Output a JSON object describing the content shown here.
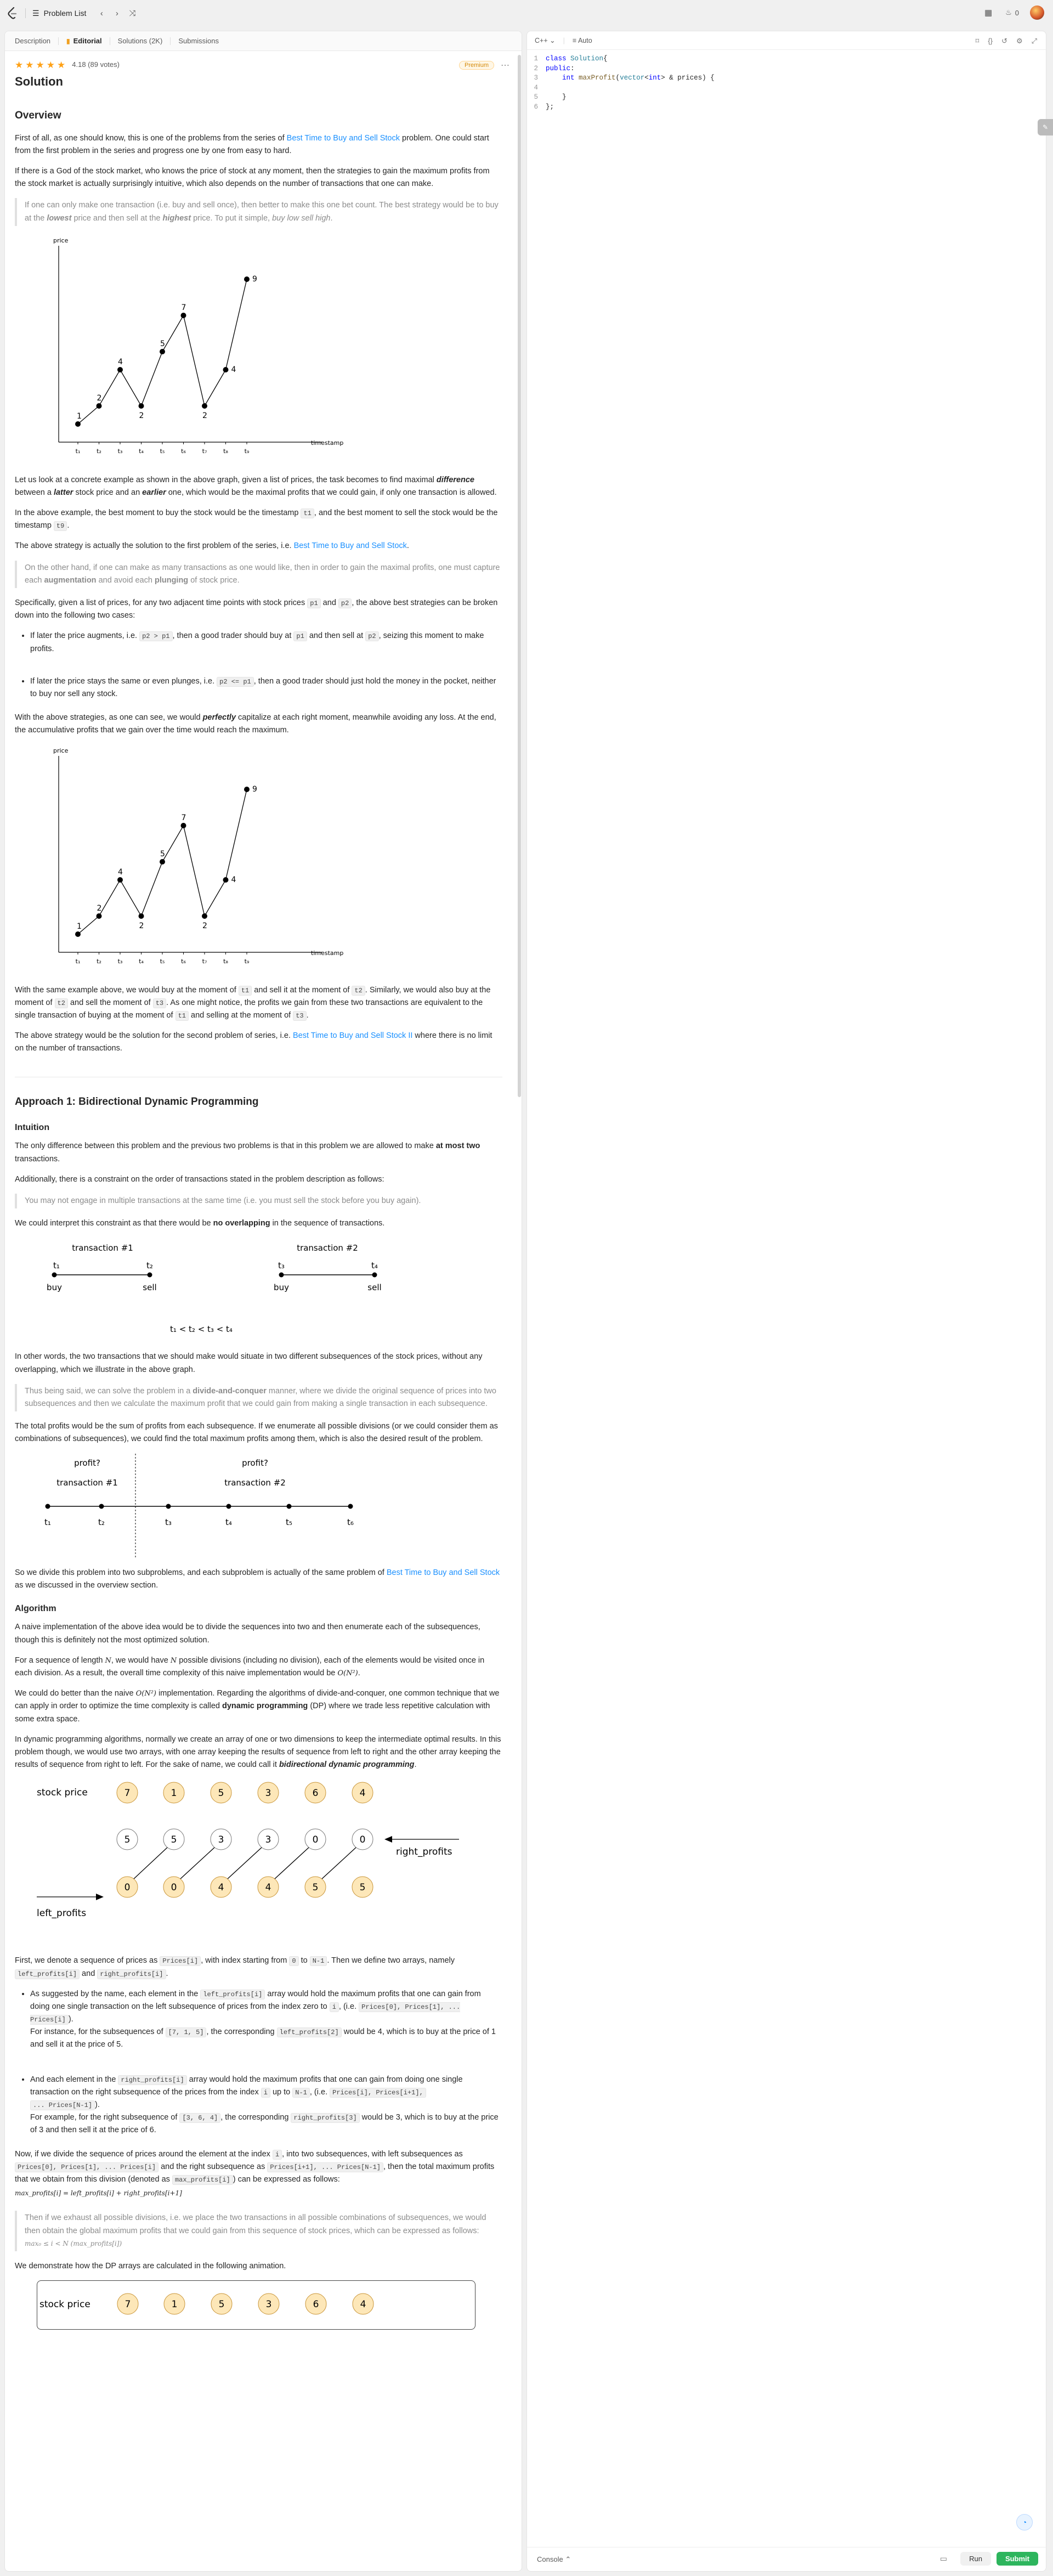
{
  "navbar": {
    "problem_list": "Problem List",
    "streak_count": "0"
  },
  "tabs": [
    {
      "label": "Description"
    },
    {
      "label": "Editorial"
    },
    {
      "label": "Solutions (2K)"
    },
    {
      "label": "Submissions"
    }
  ],
  "article": {
    "rating_text": "4.18 (89 votes)",
    "premium": "Premium",
    "title": "Solution",
    "overview_h": "Overview",
    "p1a": "First of all, as one should know, this is one of the problems from the series of ",
    "link_bs1": "Best Time to Buy and Sell Stock",
    "p1b": " problem. One could start from the first problem in the series and progress one by one from easy to hard.",
    "p2": "If there is a God of the stock market, who knows the price of stock at any moment, then the strategies to gain the maximum profits from the stock market is actually surprisingly intuitive, which also depends on the number of transactions that one can make.",
    "q1a": "If one can only make one transaction (i.e. buy and sell once), then better to make this one bet count. The best strategy would be to buy at the ",
    "q1_lowest": "lowest",
    "q1b": " price and then sell at the ",
    "q1_highest": "highest",
    "q1c": " price. To put it simple, ",
    "q1_em": "buy low sell high",
    "q1d": ".",
    "p3a": "Let us look at a concrete example as shown in the above graph, given a list of prices, the task becomes to find maximal ",
    "p3_diff": "difference",
    "p3b": " between a ",
    "p3_latter": "latter",
    "p3c": " stock price and an ",
    "p3_earlier": "earlier",
    "p3d": " one, which would be the maximal profits that we could gain, if only one transaction is allowed.",
    "p4a": "In the above example, the best moment to buy the stock would be the timestamp ",
    "p4_t1": "t1",
    "p4b": ", and the best moment to sell the stock would be the timestamp ",
    "p4_t9": "t9",
    "p4c": ".",
    "p5a": "The above strategy is actually the solution to the first problem of the series, i.e. ",
    "p5_link": "Best Time to Buy and Sell Stock",
    "p5b": ".",
    "q2a": "On the other hand, if one can make as many transactions as one would like, then in order to gain the maximal profits, one must capture each ",
    "q2_aug": "augmentation",
    "q2b": " and avoid each ",
    "q2_plunge": "plunging",
    "q2c": " of stock price.",
    "p6a": "Specifically, given a list of prices, for any two adjacent time points with stock prices ",
    "p6_p1": "p1",
    "p6b": " and ",
    "p6_p2": "p2",
    "p6c": ", the above best strategies can be broken down into the following two cases:",
    "li1a": "If later the price augments, i.e. ",
    "li1_code": "p2 > p1",
    "li1b": ", then a good trader should buy at ",
    "li1_p1": "p1",
    "li1c": " and then sell at ",
    "li1_p2": "p2",
    "li1d": ", seizing this moment to make profits.",
    "li2a": "If later the price stays the same or even plunges, i.e. ",
    "li2_code": "p2 <= p1",
    "li2b": ", then a good trader should just hold the money in the pocket, neither to buy nor sell any stock.",
    "p7a": "With the above strategies, as one can see, we would ",
    "p7_perf": "perfectly",
    "p7b": " capitalize at each right moment, meanwhile avoiding any loss. At the end, the accumulative profits that we gain over the time would reach the maximum.",
    "p8a": "With the same example above, we would buy at the moment of ",
    "p8_t1": "t1",
    "p8b": " and sell it at the moment of ",
    "p8_t2": "t2",
    "p8c": ". Similarly, we would also buy at the moment of ",
    "p8_t2b": "t2",
    "p8d": " and sell the moment of ",
    "p8_t3": "t3",
    "p8e": ". As one might notice, the profits we gain from these two transactions are equivalent to the single transaction of buying at the moment of ",
    "p8_t1b": "t1",
    "p8f": " and selling at the moment of ",
    "p8_t3b": "t3",
    "p8g": ".",
    "p9a": "The above strategy would be the solution for the second problem of series, i.e. ",
    "p9_link": "Best Time to Buy and Sell Stock II",
    "p9b": " where there is no limit on the number of transactions.",
    "approach_h": "Approach 1: Bidirectional Dynamic Programming",
    "intuition_h": "Intuition",
    "p10a": "The only difference between this problem and the previous two problems is that in this problem we are allowed to make ",
    "p10_strong": "at most two",
    "p10b": " transactions.",
    "p11": "Additionally, there is a constraint on the order of transactions stated in the problem description as follows:",
    "q3": "You may not engage in multiple transactions at the same time (i.e. you must sell the stock before you buy again).",
    "p12a": "We could interpret this constraint as that there would be ",
    "p12_strong": "no overlapping",
    "p12b": " in the sequence of transactions.",
    "p13": "In other words, the two transactions that we should make would situate in two different subsequences of the stock prices, without any overlapping, which we illustrate in the above graph.",
    "q4a": "Thus being said, we can solve the problem in a ",
    "q4_strong": "divide-and-conquer",
    "q4b": " manner, where we divide the original sequence of prices into two subsequences and then we calculate the maximum profit that we could gain from making a single transaction in each subsequence.",
    "p14": "The total profits would be the sum of profits from each subsequence. If we enumerate all possible divisions (or we could consider them as combinations of subsequences), we could find the total maximum profits among them, which is also the desired result of the problem.",
    "p15a": "So we divide this problem into two subproblems, and each subproblem is actually of the same problem of ",
    "p15_link": "Best Time to Buy and Sell Stock",
    "p15b": " as we discussed in the overview section.",
    "algorithm_h": "Algorithm",
    "p16": "A naive implementation of the above idea would be to divide the sequences into two and then enumerate each of the subsequences, though this is definitely not the most optimized solution.",
    "p17a": "For a sequence of length ",
    "p17_N": "N",
    "p17b": ", we would have ",
    "p17_N2": "N",
    "p17c": " possible divisions (including no division), each of the elements would be visited once in each division. As a result, the overall time complexity of this naive implementation would be ",
    "p17_O": "O(N²)",
    "p17d": ".",
    "p18a": "We could do better than the naive ",
    "p18_O": "O(N²)",
    "p18b": " implementation. Regarding the algorithms of divide-and-conquer, one common technique that we can apply in order to optimize the time complexity is called ",
    "p18_strong": "dynamic programming",
    "p18c": " (DP) where we trade less repetitive calculation with some extra space.",
    "p19a": "In dynamic programming algorithms, normally we create an array of one or two dimensions to keep the intermediate optimal results. In this problem though, we would use two arrays, with one array keeping the results of sequence from left to right and the other array keeping the results of sequence from right to left. For the sake of name, we could call it ",
    "p19_em": "bidirectional dynamic programming",
    "p19b": ".",
    "p20a": "First, we denote a sequence of prices as ",
    "p20_prices": "Prices[i]",
    "p20b": ", with index starting from ",
    "p20_0": "0",
    "p20c": " to ",
    "p20_N1": "N-1",
    "p20d": ". Then we define two arrays, namely ",
    "p20_lp": "left_profits[i]",
    "p20e": " and ",
    "p20_rp": "right_profits[i]",
    "p20f": ".",
    "li3a": "As suggested by the name, each element in the ",
    "li3_lp": "left_profits[i]",
    "li3b": " array would hold the maximum profits that one can gain from doing one single transaction on the left subsequence of prices from the index zero to ",
    "li3_i": "i",
    "li3c": ", (i.e. ",
    "li3_seq": "Prices[0], Prices[1], ... Prices[i]",
    "li3d": ").",
    "li3e": "For instance, for the subsequences of ",
    "li3_ex": "[7, 1, 5]",
    "li3f": ", the corresponding ",
    "li3_lp2": "left_profits[2]",
    "li3g": " would be 4, which is to buy at the price of 1 and sell it at the price of 5.",
    "li4a": "And each element in the ",
    "li4_rp": "right_profits[i]",
    "li4b": " array would hold the maximum profits that one can gain from doing one single transaction on the right subsequence of the prices from the index ",
    "li4_i": "i",
    "li4c": " up to ",
    "li4_N1": "N-1",
    "li4d": ", (i.e. ",
    "li4_seq1": "Prices[i], Prices[i+1],",
    "li4_seq2": "... Prices[N-1]",
    "li4e": ").",
    "li4f": "For example, for the right subsequence of ",
    "li4_ex": "[3, 6, 4]",
    "li4g": ", the corresponding ",
    "li4_rp2": "right_profits[3]",
    "li4h": " would be 3, which is to buy at the price of 3 and then sell it at the price of 6.",
    "p21a": "Now, if we divide the sequence of prices around the element at the index ",
    "p21_i": "i",
    "p21b": ", into two subsequences, with left subsequences as ",
    "p21_left": "Prices[0], Prices[1], ... Prices[i]",
    "p21c": " and the right subsequence as ",
    "p21_right": "Prices[i+1], ... Prices[N-1]",
    "p21d": ", then the total maximum profits that we obtain from this division (denoted as ",
    "p21_mp": "max_profits[i]",
    "p21e": ") can be expressed as follows:",
    "formula1": "max_profits[i] = left_profits[i] + right_profits[i+1]",
    "q5": "Then if we exhaust all possible divisions, i.e. we place the two transactions in all possible combinations of subsequences, we would then obtain the global maximum profits that we could gain from this sequence of stock prices, which can be expressed as follows:",
    "formula2": "max₀ ≤ i < N (max_profits[i])",
    "p22": "We demonstrate how the DP arrays are calculated in the following animation."
  },
  "fig_price": {
    "ylabel": "price",
    "xlabel": "timestamp",
    "prices": [
      1,
      2,
      4,
      2,
      5,
      7,
      2,
      4,
      9
    ],
    "ts": [
      "t₁",
      "t₂",
      "t₃",
      "t₄",
      "t₅",
      "t₆",
      "t₇",
      "t₈",
      "t₉"
    ]
  },
  "fig_trans": {
    "t1": "t₁",
    "t2": "t₂",
    "t3": "t₃",
    "t4": "t₄",
    "tr1": "transaction #1",
    "tr2": "transaction #2",
    "buy": "buy",
    "sell": "sell",
    "order": "t₁ < t₂ < t₃ < t₄"
  },
  "fig_profit": {
    "profit": "profit?",
    "tr1": "transaction #1",
    "tr2": "transaction #2",
    "ts": [
      "t₁",
      "t₂",
      "t₃",
      "t₄",
      "t₅",
      "t₆"
    ]
  },
  "fig_dp": {
    "stock_label": "stock price",
    "prices": [
      7,
      1,
      5,
      3,
      6,
      4
    ],
    "right_label": "right_profits",
    "right": [
      5,
      5,
      3,
      3,
      0,
      0
    ],
    "left_label": "left_profits",
    "left": [
      0,
      0,
      4,
      4,
      5,
      5
    ]
  },
  "editor": {
    "language": "C++",
    "mode": "Auto",
    "code_lines": [
      {
        "n": "1",
        "parts": [
          [
            "kw",
            "class "
          ],
          [
            "ty",
            "Solution"
          ],
          [
            "",
            "{"
          ]
        ]
      },
      {
        "n": "2",
        "parts": [
          [
            "kw",
            "public"
          ],
          [
            "",
            ":"
          ]
        ]
      },
      {
        "n": "3",
        "parts": [
          [
            "",
            "    "
          ],
          [
            "kw",
            "int "
          ],
          [
            "fn",
            "maxProfit"
          ],
          [
            "",
            "("
          ],
          [
            "ty",
            "vector"
          ],
          [
            "",
            "<"
          ],
          [
            "kw",
            "int"
          ],
          [
            "",
            "> & prices) {"
          ]
        ]
      },
      {
        "n": "4",
        "parts": [
          [
            "",
            ""
          ]
        ]
      },
      {
        "n": "5",
        "parts": [
          [
            "",
            "    }"
          ]
        ]
      },
      {
        "n": "6",
        "parts": [
          [
            "",
            "};"
          ]
        ]
      }
    ],
    "console": "Console",
    "run": "Run",
    "submit": "Submit"
  }
}
